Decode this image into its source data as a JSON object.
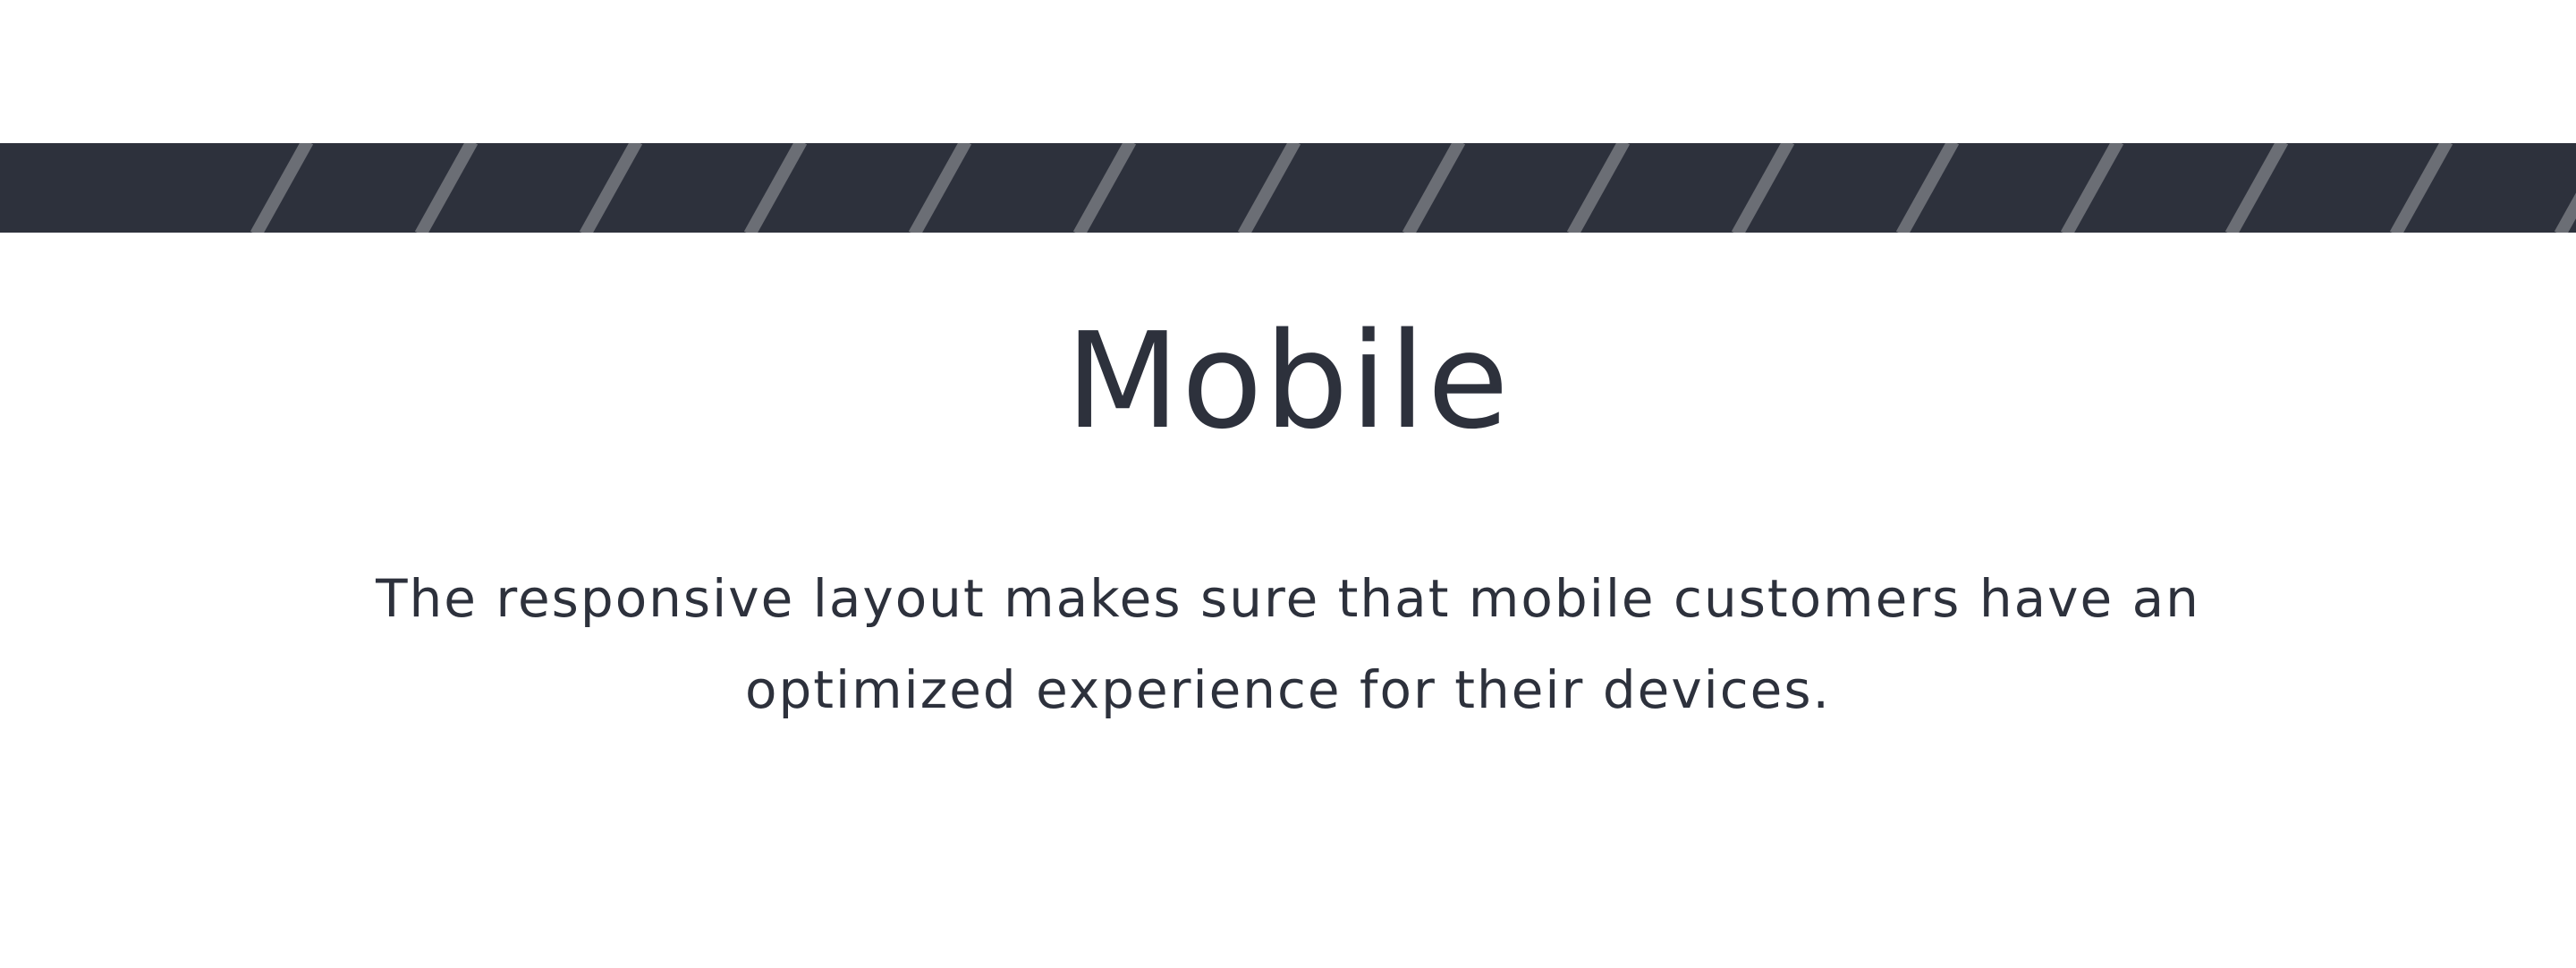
{
  "banner": {
    "background": "#2d313c",
    "stripe_color": "#6b6e75"
  },
  "section": {
    "title": "Mobile",
    "description": "The responsive layout makes sure that mobile customers have an optimized experience for their devices."
  }
}
